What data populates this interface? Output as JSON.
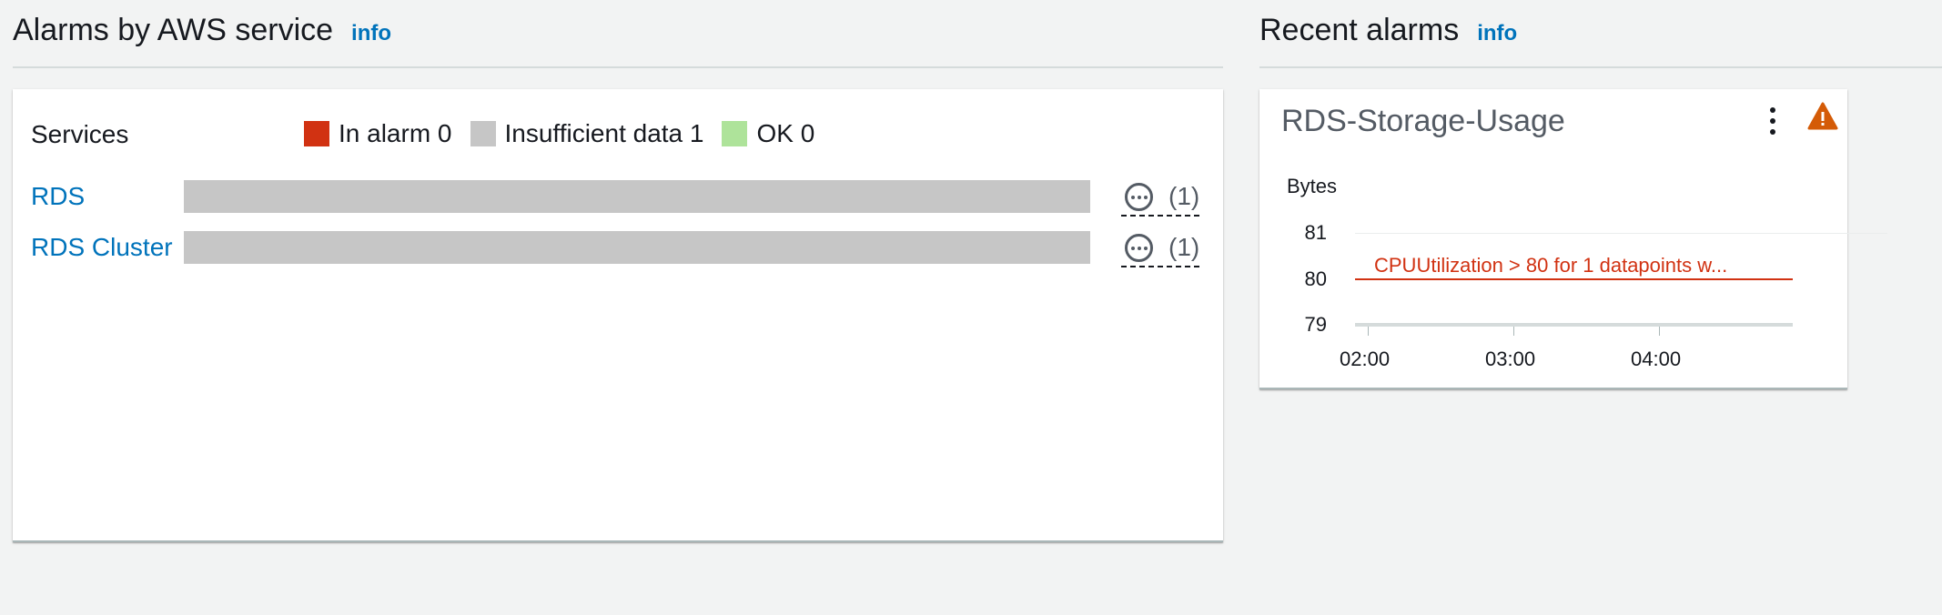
{
  "alarms_by_service": {
    "title": "Alarms by AWS service",
    "info_label": "info",
    "services_label": "Services",
    "legend": [
      {
        "label": "In alarm 0",
        "color": "#d13212"
      },
      {
        "label": "Insufficient data 1",
        "color": "#c6c6c6"
      },
      {
        "label": "OK 0",
        "color": "#aee39a"
      }
    ],
    "services": [
      {
        "name": "RDS",
        "count": "(1)",
        "bar_color": "#c6c6c6",
        "insufficient_fraction": 1.0
      },
      {
        "name": "RDS Cluster",
        "count": "(1)",
        "bar_color": "#c6c6c6",
        "insufficient_fraction": 1.0
      }
    ]
  },
  "recent_alarms": {
    "title": "Recent alarms",
    "info_label": "info",
    "widget": {
      "title": "RDS-Storage-Usage",
      "menu_icon": "kebab-menu-icon",
      "status_icon": "warning-icon",
      "status_color": "#d45b07",
      "unit": "Bytes",
      "y_ticks": [
        "81",
        "80",
        "79"
      ],
      "x_ticks": [
        "02:00",
        "03:00",
        "04:00"
      ],
      "threshold_label": "CPUUtilization > 80 for 1 datapoints w...",
      "threshold_value": 80,
      "threshold_color": "#d13212"
    }
  }
}
